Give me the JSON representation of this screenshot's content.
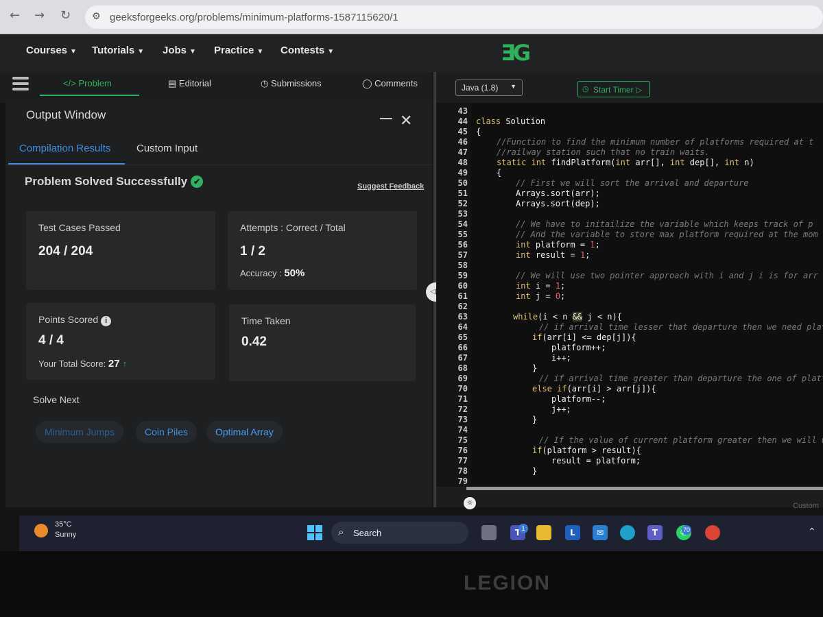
{
  "browser": {
    "url": "geeksforgeeks.org/problems/minimum-platforms-1587115620/1"
  },
  "nav": {
    "items": [
      "Courses",
      "Tutorials",
      "Jobs",
      "Practice",
      "Contests"
    ],
    "logo": "ƎG"
  },
  "problem_tabs": {
    "problem": "</> Problem",
    "editorial": "Editorial",
    "submissions": "Submissions",
    "comments": "Comments"
  },
  "output": {
    "title": "Output Window",
    "tabs": [
      "Compilation Results",
      "Custom Input"
    ],
    "status": "Problem Solved Successfully",
    "feedback": "Suggest Feedback",
    "test_cases_label": "Test Cases Passed",
    "test_cases_value": "204 / 204",
    "attempts_label": "Attempts : Correct / Total",
    "attempts_value": "1 / 2",
    "accuracy_label": "Accuracy :",
    "accuracy_value": "50%",
    "points_label": "Points Scored",
    "points_value": "4 / 4",
    "total_score_label": "Your Total Score:",
    "total_score_value": "27",
    "time_label": "Time Taken",
    "time_value": "0.42",
    "solve_next_label": "Solve Next",
    "solve_next": [
      "Minimum Jumps",
      "Coin Piles",
      "Optimal Array"
    ]
  },
  "editor": {
    "language": "Java (1.8)",
    "timer": "Start Timer",
    "line_numbers": [
      "43",
      "44",
      "45",
      "46",
      "47",
      "48",
      "49",
      "50",
      "51",
      "52",
      "53",
      "54",
      "55",
      "56",
      "57",
      "58",
      "59",
      "60",
      "61",
      "62",
      "63",
      "64",
      "65",
      "66",
      "67",
      "68",
      "69",
      "70",
      "71",
      "72",
      "73",
      "74",
      "75",
      "76",
      "77",
      "78",
      "79"
    ],
    "custom_label": "Custom"
  },
  "taskbar": {
    "temperature": "35°C",
    "condition": "Sunny",
    "search": "Search",
    "teams_badge": "1",
    "whatsapp_badge": "70"
  },
  "laptop_brand": "LEGION",
  "colors": {
    "accent_green": "#2fb15d",
    "accent_blue": "#3a8fe0",
    "panel": "#1d1f21",
    "card": "#262829"
  }
}
